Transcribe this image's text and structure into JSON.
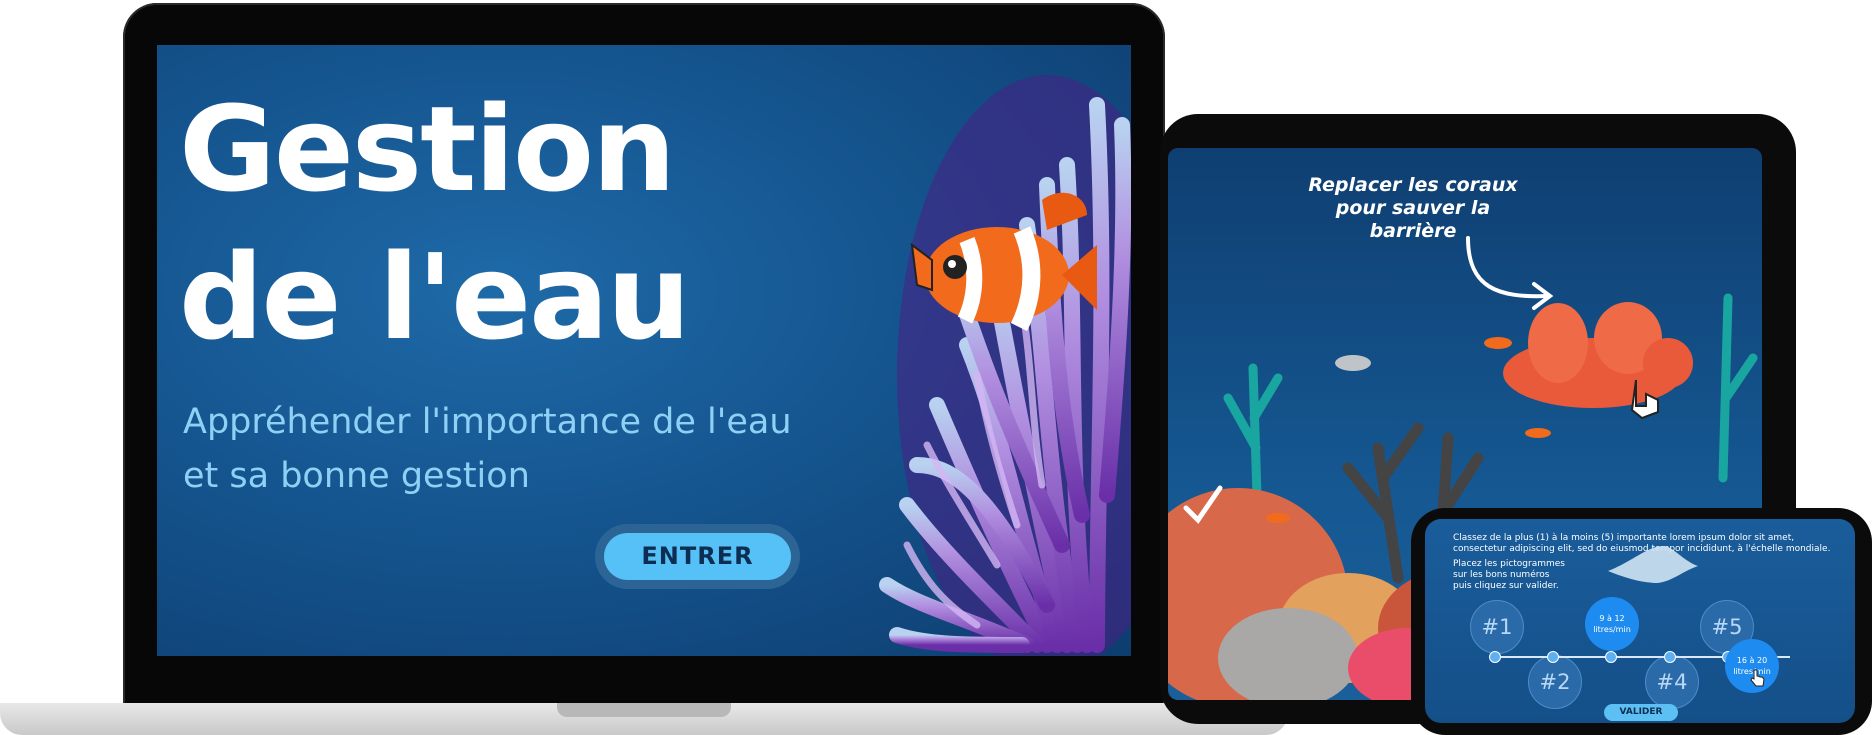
{
  "laptop": {
    "title_line1": "Gestion",
    "title_line2": "de l'eau",
    "subtitle_line1": "Appréhender l'importance de l'eau",
    "subtitle_line2": "et sa bonne gestion",
    "enter_label": "ENTRER"
  },
  "tablet": {
    "instruction_line1": "Replacer les coraux",
    "instruction_line2": "pour sauver la barrière"
  },
  "phone": {
    "instruction": "Classez de la plus (1) à la moins (5) importante lorem ipsum dolor sit amet, consectetur adipiscing elit, sed do eiusmod tempor incididunt, à l'échelle mondiale.",
    "hint": "Placez les pictogrammes sur les bons numéros puis cliquez sur valider.",
    "slots": [
      "#1",
      "#2",
      "#4",
      "#5"
    ],
    "pick1": "9 à 12 litres/min",
    "pick2": "16 à 20 litres/min",
    "validate_label": "VALIDER"
  },
  "colors": {
    "accent": "#55c1f6",
    "deep_blue": "#15558f",
    "subtitle": "#8fd0f5"
  }
}
